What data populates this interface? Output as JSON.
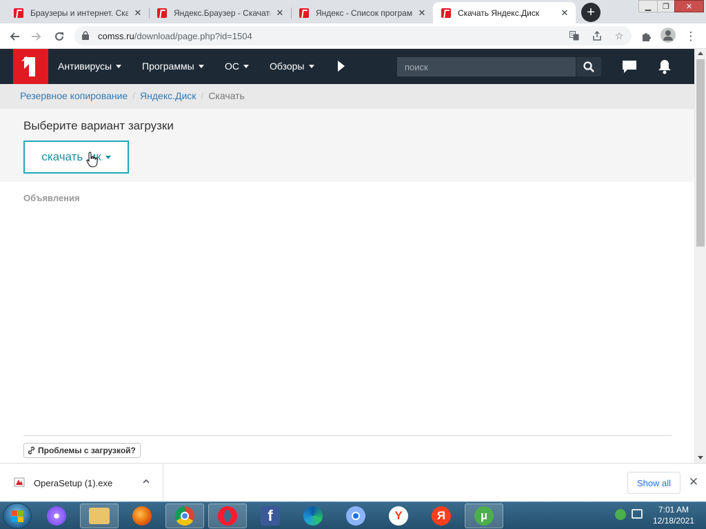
{
  "browser": {
    "tabs": [
      {
        "title": "Браузеры и интернет. Ска"
      },
      {
        "title": "Яндекс.Браузер - Скачать"
      },
      {
        "title": "Яндекс - Список програм"
      },
      {
        "title": "Скачать Яндекс.Диск"
      }
    ],
    "active_tab": 3,
    "url_host": "comss.ru",
    "url_path": "/download/page.php?id=1504"
  },
  "site": {
    "logo_alt": "1",
    "nav": [
      {
        "label": "Антивирусы"
      },
      {
        "label": "Программы"
      },
      {
        "label": "ОС"
      },
      {
        "label": "Обзоры"
      }
    ],
    "search_placeholder": "поиск",
    "accent_color": "#e11a22",
    "header_color": "#1d2a36"
  },
  "breadcrumb": [
    {
      "label": "Резервное копирование"
    },
    {
      "label": "Яндекс.Диск"
    },
    {
      "label": "Скачать"
    }
  ],
  "download": {
    "heading": "Выберите вариант загрузки",
    "button_label": "скачать .ик"
  },
  "ads_label": "Объявления",
  "problems_label": "Проблемы с загрузкой?",
  "download_shelf": {
    "file_name": "OperaSetup (1).exe",
    "show_all_label": "Show all"
  },
  "taskbar": {
    "apps": [
      "alice-icon",
      "file-explorer-icon",
      "firefox-icon",
      "chrome-icon",
      "opera-icon",
      "facebook-icon",
      "edge-icon",
      "chromium-icon",
      "yandex-browser-icon",
      "yandex-icon",
      "utorrent-icon"
    ],
    "time": "7:01 AM",
    "date": "12/18/2021"
  }
}
